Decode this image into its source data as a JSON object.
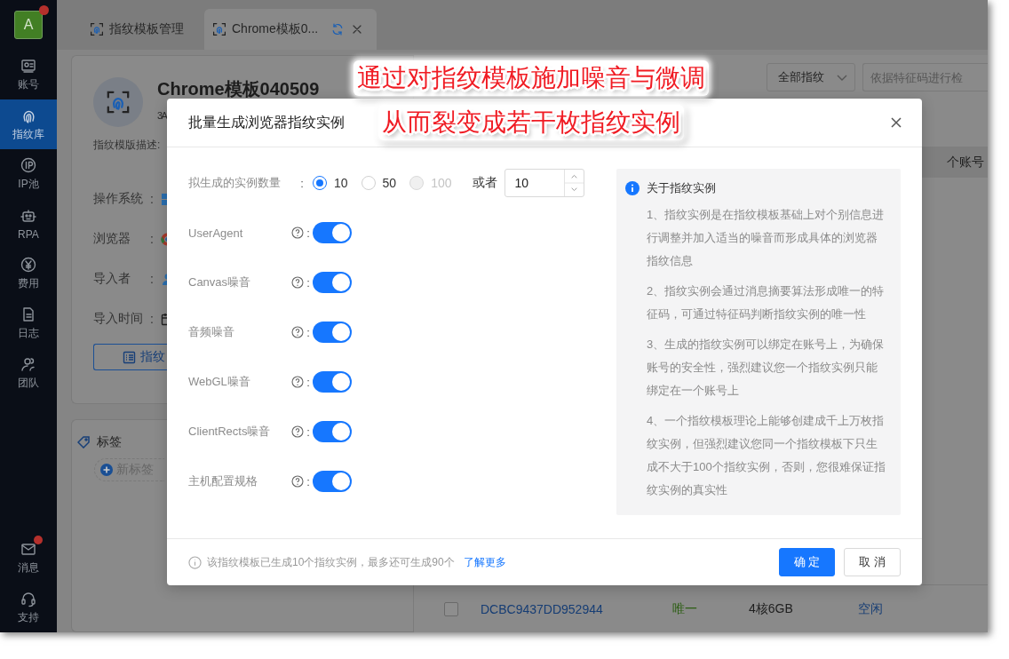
{
  "sidebar": {
    "avatar": {
      "letter": "A",
      "notification_dot": true
    },
    "items": [
      {
        "label": "账号",
        "selected": false
      },
      {
        "label": "指纹库",
        "selected": true
      },
      {
        "label": "IP池",
        "selected": false
      },
      {
        "label": "RPA",
        "selected": false
      },
      {
        "label": "费用",
        "selected": false
      },
      {
        "label": "日志",
        "selected": false
      },
      {
        "label": "团队",
        "selected": false
      }
    ],
    "bottom_items": [
      {
        "label": "消息",
        "notification_dot": true
      },
      {
        "label": "支持",
        "notification_dot": false
      }
    ]
  },
  "tabs": [
    {
      "label": "指纹模板管理",
      "selected": false
    },
    {
      "label": "Chrome模板0...",
      "selected": true
    }
  ],
  "template": {
    "name": "Chrome模板040509",
    "subtitle": "3A",
    "description_label": "指纹模版描述:",
    "fields": [
      {
        "label": "操作系统",
        "colon": ":"
      },
      {
        "label": "浏览器",
        "colon": ":"
      },
      {
        "label": "导入者",
        "colon": ":"
      },
      {
        "label": "导入时间",
        "colon": ":"
      }
    ],
    "button": "指纹"
  },
  "tags": {
    "title": "标签",
    "add_label": "新标签"
  },
  "filter": {
    "dropdown": "全部指纹",
    "search_placeholder": "依据特征码进行检"
  },
  "table": {
    "header_partial": "个账号",
    "rows": [
      {
        "checked": false,
        "code": "DCBC9437DD952944",
        "uniqueness": "唯一",
        "spec": "4核6GB",
        "status": "空闲"
      }
    ]
  },
  "dialog": {
    "title": "批量生成浏览器指纹实例",
    "quantity": {
      "label": "拟生成的实例数量",
      "colon": ":",
      "options": [
        {
          "label": "10",
          "selected": true,
          "disabled": false
        },
        {
          "label": "50",
          "selected": false,
          "disabled": false
        },
        {
          "label": "100",
          "selected": false,
          "disabled": true
        }
      ],
      "or_label": "或者",
      "value": "10"
    },
    "switches": [
      {
        "label": "UserAgent",
        "colon": ":",
        "on": true
      },
      {
        "label": "Canvas噪音",
        "colon": ":",
        "on": true
      },
      {
        "label": "音频噪音",
        "colon": ":",
        "on": true
      },
      {
        "label": "WebGL噪音",
        "colon": ":",
        "on": true
      },
      {
        "label": "ClientRects噪音",
        "colon": ":",
        "on": true
      },
      {
        "label": "主机配置规格",
        "colon": ":",
        "on": true
      }
    ],
    "info": {
      "title": "关于指纹实例",
      "paragraphs": [
        "1、指纹实例是在指纹模板基础上对个别信息进行调整并加入适当的噪音而形成具体的浏览器指纹信息",
        "2、指纹实例会通过消息摘要算法形成唯一的特征码，可通过特征码判断指纹实例的唯一性",
        "3、生成的指纹实例可以绑定在账号上，为确保账号的安全性，强烈建议您一个指纹实例只能绑定在一个账号上",
        "4、一个指纹模板理论上能够创建成千上万枚指纹实例，但强烈建议您同一个指纹模板下只生成不大于100个指纹实例，否则，您很难保证指纹实例的真实性"
      ]
    },
    "footer_note": "该指纹模板已生成10个指纹实例，最多还可生成90个",
    "learn_more": "了解更多",
    "buttons": [
      {
        "label": "确 定",
        "kind": "primary"
      },
      {
        "label": "取 消",
        "kind": "default"
      }
    ]
  },
  "annotation": [
    "通过对指纹模板施加噪音与微调",
    "从而裂变成若干枚指纹实例"
  ]
}
